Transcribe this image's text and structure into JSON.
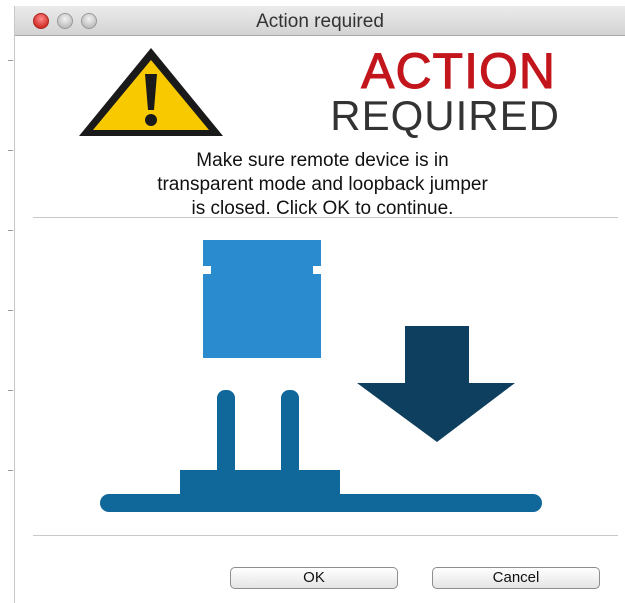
{
  "window": {
    "title": "Action required"
  },
  "header": {
    "line1": "ACTION",
    "line2": "REQUIRED",
    "line1_color": "#c2161c",
    "line2_color": "#333333",
    "warning_icon": "warning-triangle-icon",
    "warning_color": "#f9c900"
  },
  "message": {
    "lines": [
      "Make sure remote device is in",
      "transparent mode and loopback jumper",
      "is closed. Click OK to continue."
    ]
  },
  "illustration": {
    "jumper_color": "#2a8bcf",
    "header_color": "#10679a",
    "arrow_color": "#0f3f5e",
    "arrow_icon": "arrow-down-icon"
  },
  "buttons": {
    "ok_label": "OK",
    "cancel_label": "Cancel"
  }
}
